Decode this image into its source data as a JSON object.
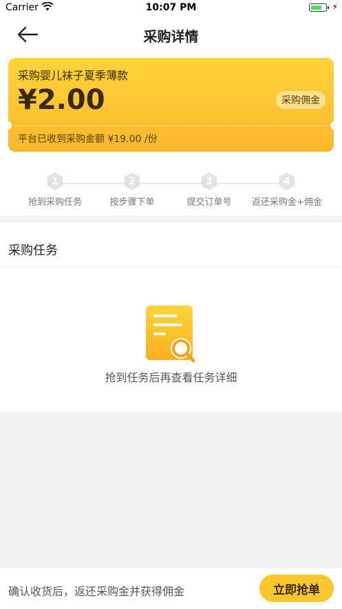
{
  "status_bar": {
    "carrier": "Carrier",
    "time": "10:07 PM",
    "battery_level": 0.75
  },
  "nav": {
    "title": "采购详情"
  },
  "card": {
    "product_name": "采购婴儿袜子夏季薄款",
    "commission_price": "¥2.00",
    "tag": "采购佣金",
    "platform_received": "平台已收到采购金额 ¥19.00 /份"
  },
  "steps": [
    {
      "num": "1",
      "label": "抢到采购任务"
    },
    {
      "num": "2",
      "label": "按步骤下单"
    },
    {
      "num": "3",
      "label": "提交订单号"
    },
    {
      "num": "4",
      "label": "返还采购金+佣金"
    }
  ],
  "task_section": {
    "title": "采购任务",
    "empty_text": "抢到任务后再查看任务详细"
  },
  "bottom": {
    "hint": "确认收货后，返还采购金并获得佣金",
    "button": "立即抢单"
  },
  "colors": {
    "accent": "#fcc72e",
    "card_top": "#ffd43b",
    "card_bottom": "#fbb72b"
  }
}
